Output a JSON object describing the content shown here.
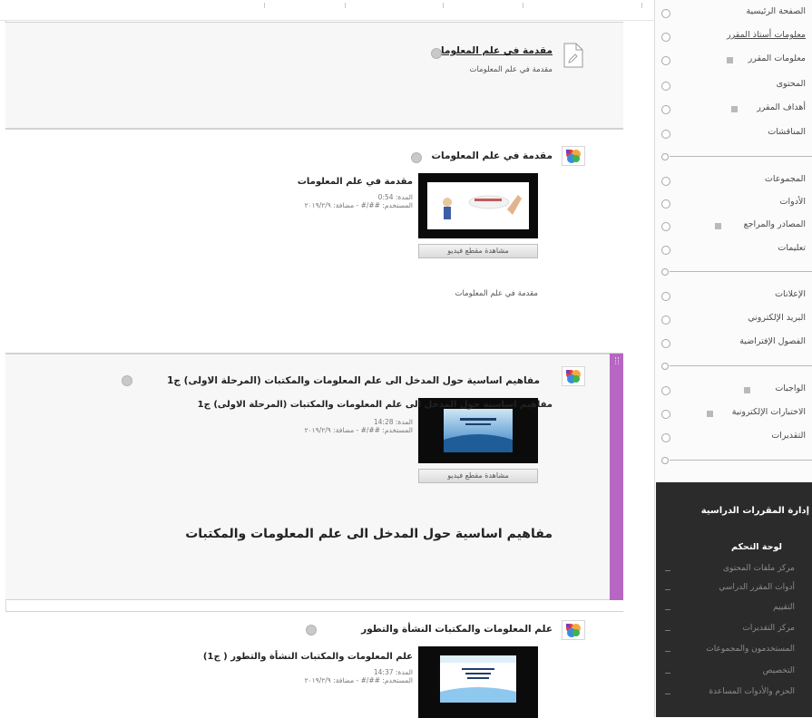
{
  "sidebar": {
    "items": [
      {
        "label": "الصفحة الرئيسية"
      },
      {
        "label": "معلومات أستاذ المقرر",
        "underline": true
      },
      {
        "label": "معلومات المقرر",
        "badge": true
      },
      {
        "label": "المحتوى"
      },
      {
        "label": "أهداف المقرر",
        "badge": true
      },
      {
        "label": "المناقشات"
      },
      {
        "label": "المجموعات"
      },
      {
        "label": "الأدوات"
      },
      {
        "label": "المصادر والمراجع",
        "badge": true
      },
      {
        "label": "تعليمات"
      },
      {
        "label": "الإعلانات"
      },
      {
        "label": "البريد الإلكتروني"
      },
      {
        "label": "الفصول الإفتراضية"
      },
      {
        "label": "الواجبات",
        "badge": true
      },
      {
        "label": "الاختبارات الإلكترونية",
        "badge": true
      },
      {
        "label": "التقديرات"
      }
    ]
  },
  "admin": {
    "title": "إدارة المقررات الدراسية",
    "subtitle": "لوحة التحكم",
    "items": [
      {
        "label": "مركز ملفات المحتوى"
      },
      {
        "label": "أدوات المقرر الدراسي"
      },
      {
        "label": "التقييم"
      },
      {
        "label": "مركز التقديرات"
      },
      {
        "label": "المستخدمون والمجموعات"
      },
      {
        "label": "التخصيص"
      },
      {
        "label": "الحزم والأدوات المساعدة"
      }
    ]
  },
  "content": {
    "items": [
      {
        "title": "مقدمة في علم المعلومات",
        "description": "مقدمة في علم المعلومات"
      },
      {
        "title": "مقدمة في علم المعلومات",
        "video_title": "مقدمة في علم المعلومات",
        "video_duration": "المدة: 0:54",
        "video_meta": "المستخدم: ##/# - مضافة: ٢٠١٩/٢/٩",
        "watch_button": "مشاهدة مقطع فيديو",
        "description": "مقدمة في علم المعلومات"
      },
      {
        "title": "مفاهيم اساسية حول المدخل الى علم المعلومات والمكتبات (المرحلة الاولى) ج1",
        "video_title": "مفاهيم اساسية حول المدخل الى علم المعلومات والمكتبات (المرحلة الاولى) ج1",
        "video_duration": "المدة: 14:28",
        "video_meta": "المستخدم: ##/# - مضافة: ٢٠١٩/٢/٩",
        "watch_button": "مشاهدة مقطع فيديو",
        "heading": "مفاهيم اساسية حول المدخل الى علم المعلومات والمكتبات"
      },
      {
        "title": "علم المعلومات والمكتبات النشأة والتطور",
        "video_title": "علم المعلومات والمكتبات النشأة والتطور ( ج1)",
        "video_duration": "المدة: 14:37",
        "video_meta": "المستخدم: ##/# - مضافة: ٢٠١٩/٢/٩"
      }
    ]
  },
  "colors": {
    "accent_bar": "#b866c4",
    "admin_bg": "#2b2b2b",
    "item_bg": "#f7f7f7"
  }
}
